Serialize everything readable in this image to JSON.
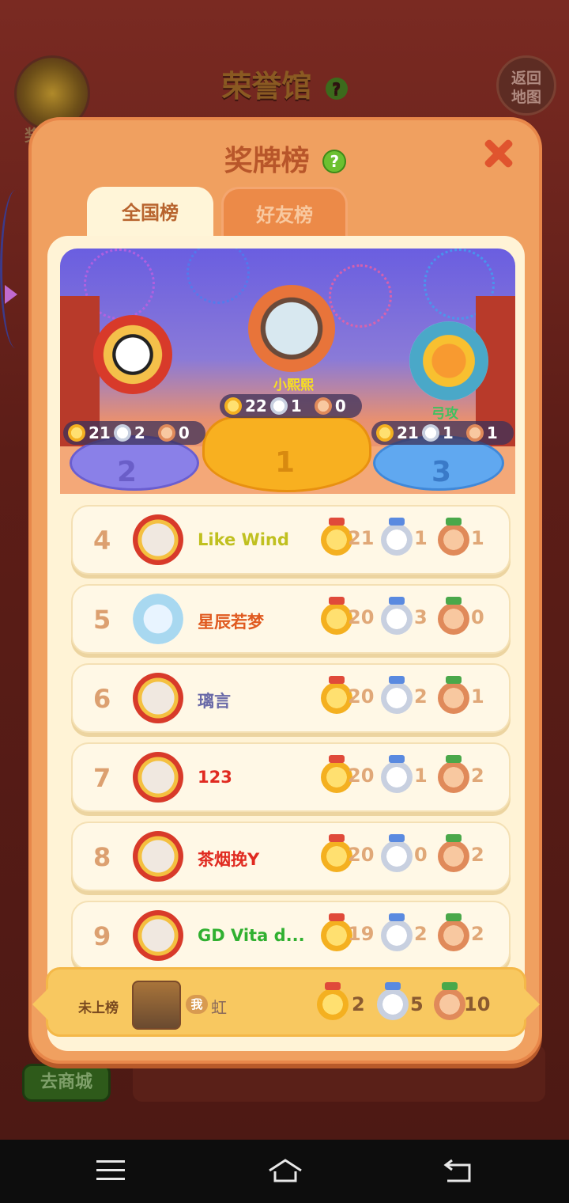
{
  "background": {
    "hall_title": "荣誉馆",
    "medal_label": "奖",
    "return_map": [
      "返回",
      "地图"
    ],
    "shop_button": "去商城"
  },
  "panel": {
    "title": "奖牌榜",
    "tabs": [
      "全国榜",
      "好友榜"
    ]
  },
  "podium": [
    {
      "rank": "1",
      "name": "小熙熙",
      "gold": "22",
      "silver": "1",
      "bronze": "0"
    },
    {
      "rank": "2",
      "name": "",
      "gold": "21",
      "silver": "2",
      "bronze": "0"
    },
    {
      "rank": "3",
      "name": "弓攻",
      "gold": "21",
      "silver": "1",
      "bronze": "1"
    }
  ],
  "rows": [
    {
      "rank": "4",
      "name": "Like  Wind",
      "name_color": "#c0c020",
      "gold": "21",
      "silver": "1",
      "bronze": "1"
    },
    {
      "rank": "5",
      "name": "星辰若梦",
      "name_color": "#e05a20",
      "gold": "20",
      "silver": "3",
      "bronze": "0"
    },
    {
      "rank": "6",
      "name": "璃言",
      "name_color": "#6a6aa8",
      "gold": "20",
      "silver": "2",
      "bronze": "1"
    },
    {
      "rank": "7",
      "name": "123",
      "name_color": "#e02a20",
      "gold": "20",
      "silver": "1",
      "bronze": "2"
    },
    {
      "rank": "8",
      "name": "茶烟挽Y",
      "name_color": "#e02a20",
      "gold": "20",
      "silver": "0",
      "bronze": "2"
    },
    {
      "rank": "9",
      "name": "GD Vita d...",
      "name_color": "#30b030",
      "gold": "19",
      "silver": "2",
      "bronze": "2"
    }
  ],
  "me": {
    "status": "未上榜",
    "badge": "我",
    "name": "虹",
    "gold": "2",
    "silver": "5",
    "bronze": "10"
  },
  "colors": {
    "panel": "#f0a060",
    "inner": "#fff3d6",
    "gold": "#f4b020",
    "silver": "#c8d0e0",
    "bronze": "#e08a5a"
  }
}
